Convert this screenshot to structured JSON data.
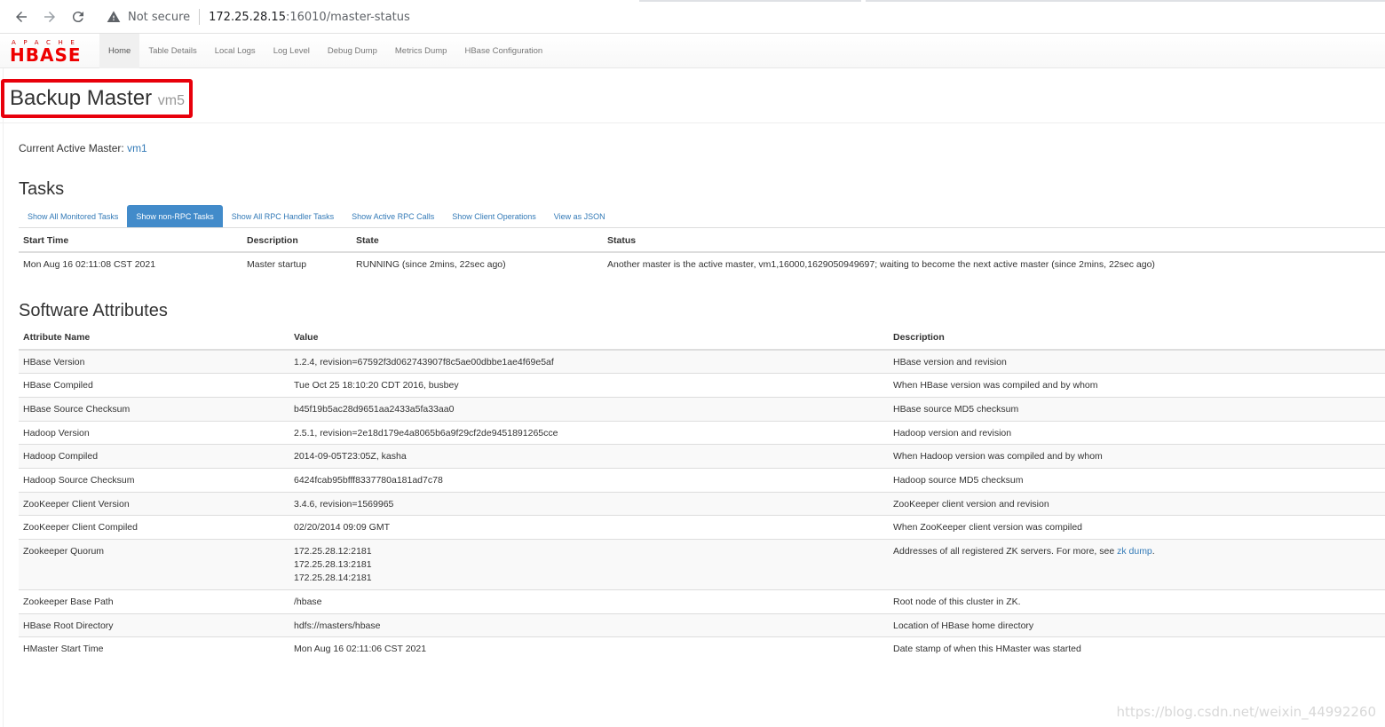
{
  "browser": {
    "not_secure": "Not secure",
    "host": "172.25.28.15",
    "path": ":16010/master-status"
  },
  "navbar": {
    "logo_apache": "APACHE",
    "logo_hbase": "HBASE",
    "items": [
      "Home",
      "Table Details",
      "Local Logs",
      "Log Level",
      "Debug Dump",
      "Metrics Dump",
      "HBase Configuration"
    ]
  },
  "header": {
    "title": "Backup Master",
    "host": "vm5"
  },
  "active_master": {
    "label": "Current Active Master:",
    "value": "vm1"
  },
  "tasks": {
    "heading": "Tasks",
    "tabs": [
      "Show All Monitored Tasks",
      "Show non-RPC Tasks",
      "Show All RPC Handler Tasks",
      "Show Active RPC Calls",
      "Show Client Operations",
      "View as JSON"
    ],
    "columns": [
      "Start Time",
      "Description",
      "State",
      "Status"
    ],
    "row": {
      "start": "Mon Aug 16 02:11:08 CST 2021",
      "description": "Master startup",
      "state": "RUNNING (since 2mins, 22sec ago)",
      "status": "Another master is the active master, vm1,16000,1629050949697; waiting to become the next active master (since 2mins, 22sec ago)"
    }
  },
  "software": {
    "heading": "Software Attributes",
    "columns": [
      "Attribute Name",
      "Value",
      "Description"
    ],
    "rows": [
      {
        "name": "HBase Version",
        "value": "1.2.4, revision=67592f3d062743907f8c5ae00dbbe1ae4f69e5af",
        "desc": "HBase version and revision"
      },
      {
        "name": "HBase Compiled",
        "value": "Tue Oct 25 18:10:20 CDT 2016, busbey",
        "desc": "When HBase version was compiled and by whom"
      },
      {
        "name": "HBase Source Checksum",
        "value": "b45f19b5ac28d9651aa2433a5fa33aa0",
        "desc": "HBase source MD5 checksum"
      },
      {
        "name": "Hadoop Version",
        "value": "2.5.1, revision=2e18d179e4a8065b6a9f29cf2de9451891265cce",
        "desc": "Hadoop version and revision"
      },
      {
        "name": "Hadoop Compiled",
        "value": "2014-09-05T23:05Z, kasha",
        "desc": "When Hadoop version was compiled and by whom"
      },
      {
        "name": "Hadoop Source Checksum",
        "value": "6424fcab95bfff8337780a181ad7c78",
        "desc": "Hadoop source MD5 checksum"
      },
      {
        "name": "ZooKeeper Client Version",
        "value": "3.4.6, revision=1569965",
        "desc": "ZooKeeper client version and revision"
      },
      {
        "name": "ZooKeeper Client Compiled",
        "value": "02/20/2014 09:09 GMT",
        "desc": "When ZooKeeper client version was compiled"
      },
      {
        "name": "Zookeeper Quorum",
        "value_lines": [
          "172.25.28.12:2181",
          "172.25.28.13:2181",
          "172.25.28.14:2181"
        ],
        "desc_prefix": "Addresses of all registered ZK servers. For more, see ",
        "desc_link": "zk dump",
        "desc_suffix": "."
      },
      {
        "name": "Zookeeper Base Path",
        "value": "/hbase",
        "desc": "Root node of this cluster in ZK."
      },
      {
        "name": "HBase Root Directory",
        "value": "hdfs://masters/hbase",
        "desc": "Location of HBase home directory"
      },
      {
        "name": "HMaster Start Time",
        "value": "Mon Aug 16 02:11:06 CST 2021",
        "desc": "Date stamp of when this HMaster was started"
      }
    ]
  },
  "watermark": "https://blog.csdn.net/weixin_44992260"
}
